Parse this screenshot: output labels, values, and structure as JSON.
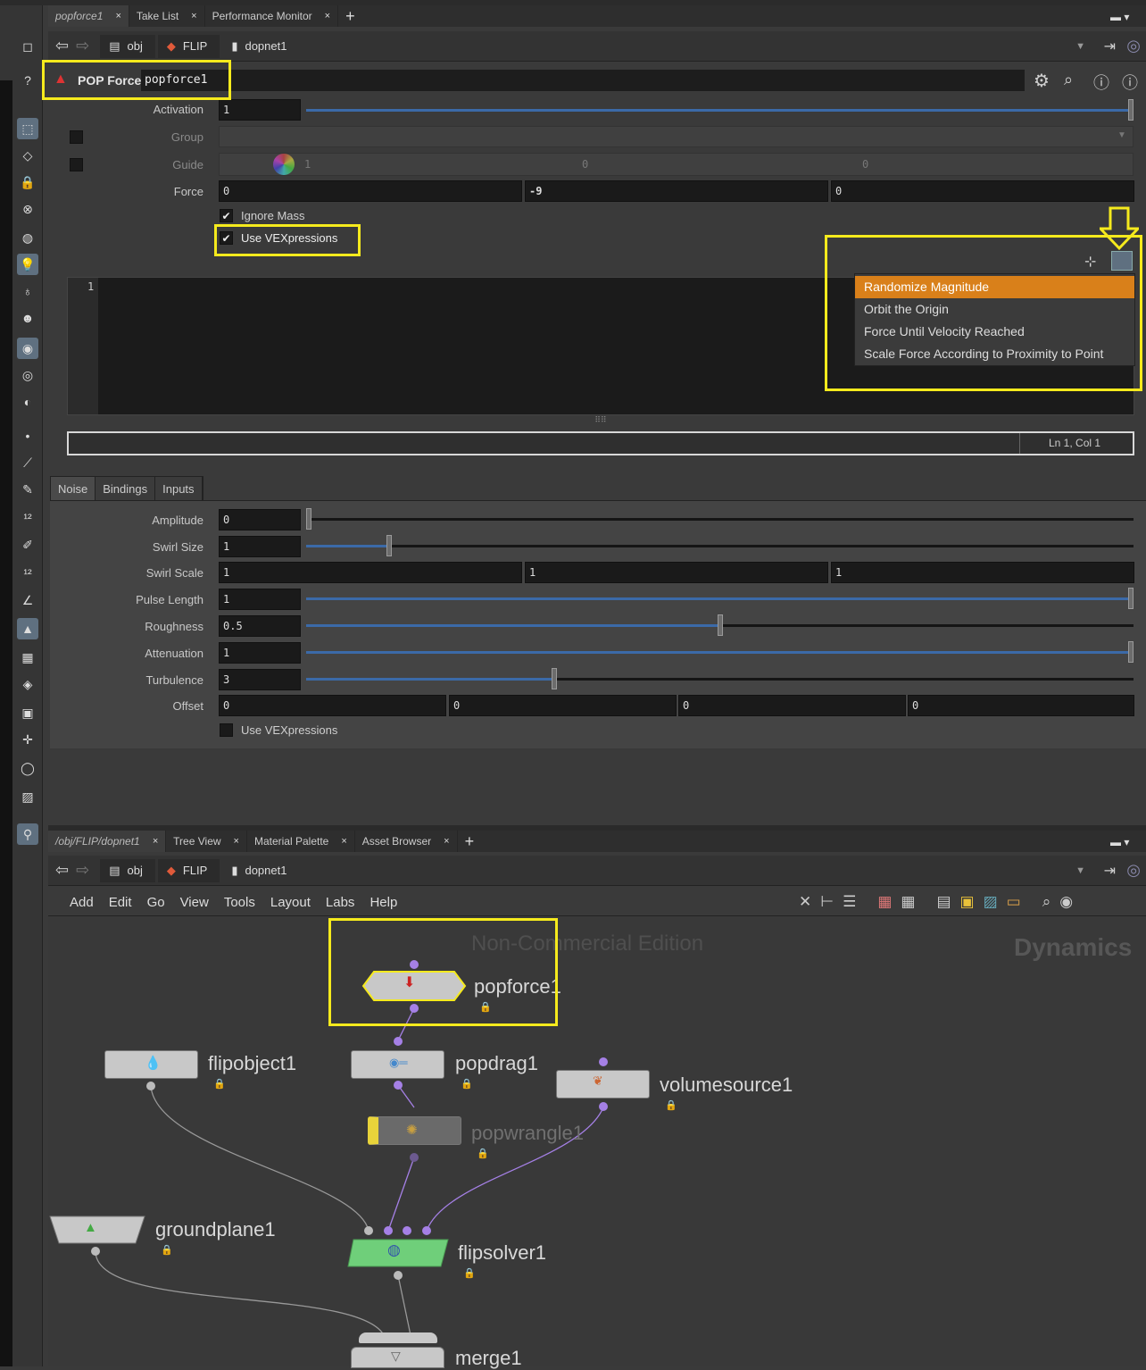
{
  "top_tabs": [
    {
      "label": "popforce1",
      "active": true
    },
    {
      "label": "Take List",
      "active": false
    },
    {
      "label": "Performance Monitor",
      "active": false
    }
  ],
  "path": {
    "obj": "obj",
    "flip": "FLIP",
    "dopnet": "dopnet1"
  },
  "node_header": {
    "type": "POP Force",
    "name": "popforce1"
  },
  "params": {
    "activation_label": "Activation",
    "activation": "1",
    "activation_frac": 1.0,
    "group_label": "Group",
    "guide_label": "Guide",
    "guide": [
      "1",
      "0",
      "0"
    ],
    "force_label": "Force",
    "force": [
      "0",
      "-9",
      "0"
    ],
    "ignore_mass": "Ignore Mass",
    "use_vex": "Use VEXpressions"
  },
  "editor": {
    "line_number": "1",
    "status": "Ln 1, Col 1"
  },
  "vex_menu": [
    "Randomize Magnitude",
    "Orbit the Origin",
    "Force Until Velocity Reached",
    "Scale Force According to Proximity to Point"
  ],
  "noise_tabs": [
    "Noise",
    "Bindings",
    "Inputs"
  ],
  "noise": {
    "amplitude_label": "Amplitude",
    "amplitude": "0",
    "amplitude_frac": 0.0,
    "swirl_size_label": "Swirl Size",
    "swirl_size": "1",
    "swirl_size_frac": 0.1,
    "swirl_scale_label": "Swirl Scale",
    "swirl_scale": [
      "1",
      "1",
      "1"
    ],
    "pulse_length_label": "Pulse Length",
    "pulse_length": "1",
    "pulse_length_frac": 1.0,
    "roughness_label": "Roughness",
    "roughness": "0.5",
    "roughness_frac": 0.5,
    "attenuation_label": "Attenuation",
    "attenuation": "1",
    "attenuation_frac": 1.0,
    "turbulence_label": "Turbulence",
    "turbulence": "3",
    "turbulence_frac": 0.3,
    "offset_label": "Offset",
    "offset": [
      "0",
      "0",
      "0",
      "0"
    ],
    "use_vex": "Use VEXpressions"
  },
  "bottom_tabs": [
    "/obj/FLIP/dopnet1",
    "Tree View",
    "Material Palette",
    "Asset Browser"
  ],
  "network_menu": [
    "Add",
    "Edit",
    "Go",
    "View",
    "Tools",
    "Layout",
    "Labs",
    "Help"
  ],
  "network": {
    "watermark": "Non-Commercial Edition",
    "context": "Dynamics",
    "nodes": {
      "popforce": "popforce1",
      "flipobject": "flipobject1",
      "popdrag": "popdrag1",
      "volumesource": "volumesource1",
      "popwrangle": "popwrangle1",
      "groundplane": "groundplane1",
      "flipsolver": "flipsolver1",
      "merge": "merge1"
    }
  },
  "colors": {
    "highlight": "#f5ea1d",
    "menu_selected": "#d9801a",
    "slider_fill": "#3b6aa8",
    "solver_green": "#6fcf7a",
    "wire_purple": "#a580e6"
  }
}
